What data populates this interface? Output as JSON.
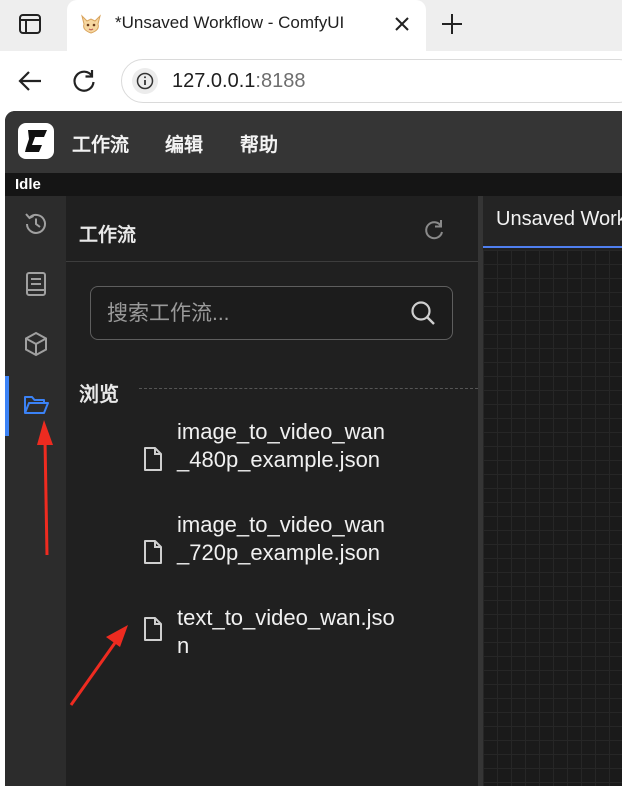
{
  "browser": {
    "tab_title": "*Unsaved Workflow - ComfyUI",
    "url_host": "127.0.0.1",
    "url_port": ":8188"
  },
  "app": {
    "menu": [
      "工作流",
      "编辑",
      "帮助"
    ],
    "status": "Idle"
  },
  "sidebar_icons": [
    "history-icon",
    "book-icon",
    "cube-icon",
    "folder-open-icon"
  ],
  "panel": {
    "title": "工作流",
    "search_placeholder": "搜索工作流...",
    "browse_label": "浏览",
    "files": [
      "image_to_video_wan_480p_example.json",
      "image_to_video_wan_720p_example.json",
      "text_to_video_wan.json"
    ]
  },
  "canvas": {
    "tab_label": "Unsaved Workflow"
  },
  "colors": {
    "accent": "#3b82f6",
    "annotation_arrow": "#ee2b20"
  }
}
